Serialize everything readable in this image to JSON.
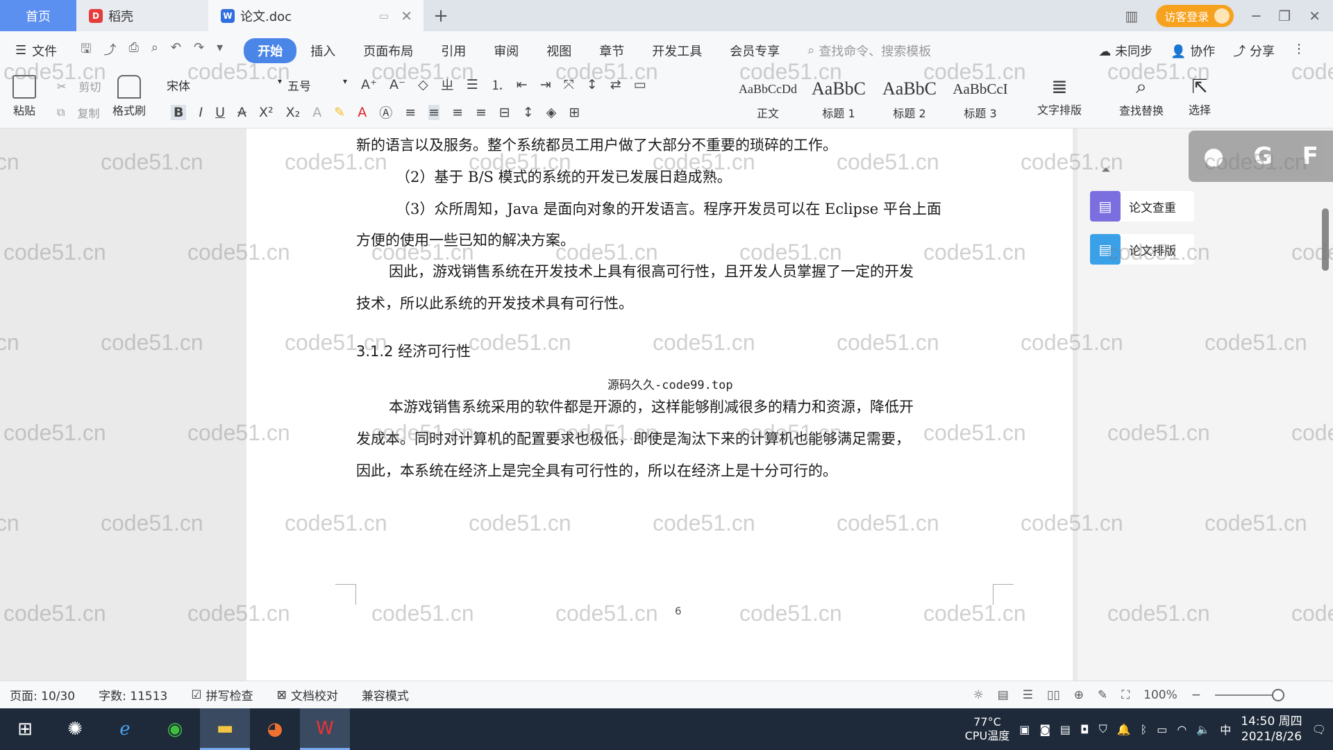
{
  "tabs": {
    "home": "首页",
    "daoke": "稻壳",
    "doc": "论文.doc"
  },
  "titlebar": {
    "login": "访客登录"
  },
  "menubar": {
    "file": "文件",
    "items": [
      "开始",
      "插入",
      "页面布局",
      "引用",
      "审阅",
      "视图",
      "章节",
      "开发工具",
      "会员专享"
    ],
    "search": "查找命令、搜索模板",
    "right": [
      "未同步",
      "协作",
      "分享"
    ]
  },
  "ribbon": {
    "paste": "粘贴",
    "cut": "剪切",
    "copy": "复制",
    "format_painter": "格式刷",
    "font": "宋体",
    "size": "五号",
    "styles": [
      {
        "sample": "AaBbCcDd",
        "label": "正文"
      },
      {
        "sample": "AaBbC",
        "label": "标题 1"
      },
      {
        "sample": "AaBbC",
        "label": "标题 2"
      },
      {
        "sample": "AaBbCcI",
        "label": "标题 3"
      }
    ],
    "text_layout": "文字排版",
    "find_replace": "查找替换",
    "select": "选择"
  },
  "document": {
    "lines": [
      "新的语言以及服务。整个系统都员工用户做了大部分不重要的琐碎的工作。",
      "（2）基于 B/S 模式的系统的开发已发展日趋成熟。",
      "（3）众所周知，Java 是面向对象的开发语言。程序开发员可以在 Eclipse 平台上面",
      "方便的使用一些已知的解决方案。",
      "因此，游戏销售系统在开发技术上具有很高可行性，且开发人员掌握了一定的开发",
      "技术，所以此系统的开发技术具有可行性。"
    ],
    "heading": "3.1.2 经济可行性",
    "source_note": "源码久久-code99.top",
    "para2": [
      "本游戏销售系统采用的软件都是开源的，这样能够削减很多的精力和资源，降低开",
      "发成本。同时对计算机的配置要求也极低，即使是淘汰下来的计算机也能够满足需要，",
      "因此，本系统在经济上是完全具有可行性的，所以在经济上是十分可行的。"
    ],
    "page_number": "6"
  },
  "sidepanel": {
    "check": "论文查重",
    "layout": "论文排版"
  },
  "watermark": "code51.cn",
  "statusbar": {
    "page": "页面: 10/30",
    "words": "字数: 11513",
    "spell": "拼写检查",
    "proof": "文档校对",
    "compat": "兼容模式",
    "zoom": "100%"
  },
  "taskbar": {
    "weather_temp": "77°C",
    "weather_label": "CPU温度",
    "time": "14:50 周四",
    "date": "2021/8/26",
    "ime": "中"
  }
}
